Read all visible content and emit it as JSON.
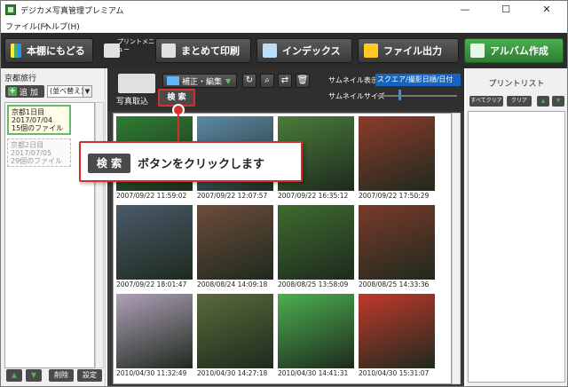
{
  "window": {
    "title": "デジカメ写真管理プレミアム",
    "minimize": "—",
    "maximize": "☐",
    "close": "✕"
  },
  "menu": {
    "file": "ファイル(F)",
    "help": "ヘルプ(H)"
  },
  "toolbar": {
    "back": "本棚にもどる",
    "print_menu": "プリントメニュー",
    "batch_print": "まとめて印刷",
    "index": "インデックス",
    "file_output": "ファイル出力",
    "album_create": "アルバム作成"
  },
  "left": {
    "folder_title": "京都旅行",
    "add": "追 加",
    "add_plus": "+",
    "sort": "(並べ替え)",
    "albums": [
      {
        "name": "京都1日目",
        "date": "2017/07/04",
        "count": "15個のファイル"
      },
      {
        "name": "京都2日目",
        "date": "2017/07/05",
        "count": "29個のファイル"
      }
    ],
    "up": "▲",
    "down": "▼",
    "delete": "削除",
    "settings": "設定"
  },
  "center": {
    "import": "写真取込",
    "edit": "補正・編集",
    "search": "検 索",
    "thumb_display_label": "サムネイル表示",
    "thumb_display_value": "スクエア/撮影日順/日付",
    "thumb_size_label": "サムネイルサイズ",
    "thumb_size_level": 0.27,
    "photos": [
      {
        "date": "2007/09/22 11:59:02",
        "color": "#2e7d32"
      },
      {
        "date": "2007/09/22 12:07:57",
        "color": "#5d8aa8"
      },
      {
        "date": "2007/09/22 16:35:12",
        "color": "#4a7c3a"
      },
      {
        "date": "2007/09/22 17:50:29",
        "color": "#8d3b2a"
      },
      {
        "date": "2007/09/22 18:01:47",
        "color": "#4a5a6a"
      },
      {
        "date": "2008/08/24 14:09:18",
        "color": "#6d4c3b"
      },
      {
        "date": "2008/08/25 13:58:09",
        "color": "#3e6b2e"
      },
      {
        "date": "2008/08/25 14:33:36",
        "color": "#7a3a2a"
      },
      {
        "date": "2010/04/30 11:32:49",
        "color": "#b0a0b8"
      },
      {
        "date": "2010/04/30 14:27:18",
        "color": "#5a6a3a"
      },
      {
        "date": "2010/04/30 14:41:31",
        "color": "#4caf50"
      },
      {
        "date": "2010/04/30 15:31:07",
        "color": "#c0392b"
      }
    ]
  },
  "right": {
    "title": "プリントリスト",
    "select_all": "すべてクリア",
    "clear": "クリア",
    "up": "▲",
    "down": "▼"
  },
  "callout": {
    "key": "検 索",
    "text": "ボタンをクリックします"
  }
}
